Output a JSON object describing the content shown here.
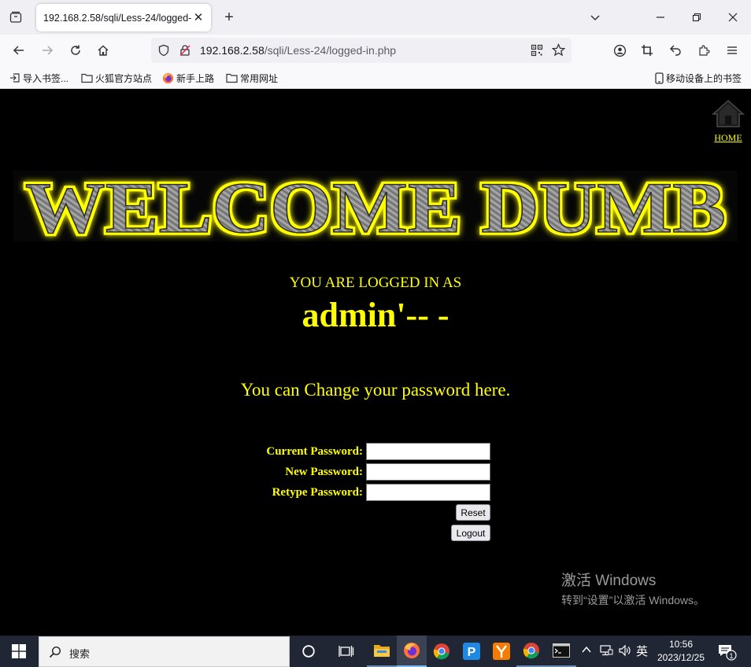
{
  "browser": {
    "tab_title": "192.168.2.58/sqli/Less-24/logged-in.php",
    "url_host": "192.168.2.58",
    "url_path": "/sqli/Less-24/logged-in.php",
    "bookmarks": [
      "导入书签...",
      "火狐官方站点",
      "新手上路",
      "常用网址"
    ],
    "mobile_bookmarks": "移动设备上的书签"
  },
  "page": {
    "home_label": "HOME",
    "banner_text": "WELCOME DUMB",
    "logged_in_label": "YOU ARE LOGGED IN AS",
    "username": "admin'-- -",
    "change_message": "You can Change your password here.",
    "form": {
      "current_label": "Current Password:",
      "new_label": "New Password:",
      "retype_label": "Retype Password:",
      "current_value": "",
      "new_value": "",
      "retype_value": "",
      "reset_label": "Reset",
      "logout_label": "Logout"
    },
    "activate_line1": "激活 Windows",
    "activate_line2": "转到“设置”以激活 Windows。"
  },
  "taskbar": {
    "search_placeholder": "搜索",
    "ime": "英",
    "time": "10:56",
    "date": "2023/12/25",
    "notification_count": "1"
  },
  "colors": {
    "page_bg": "#000000",
    "page_text": "#ffff00",
    "taskbar_bg": "#202633"
  }
}
